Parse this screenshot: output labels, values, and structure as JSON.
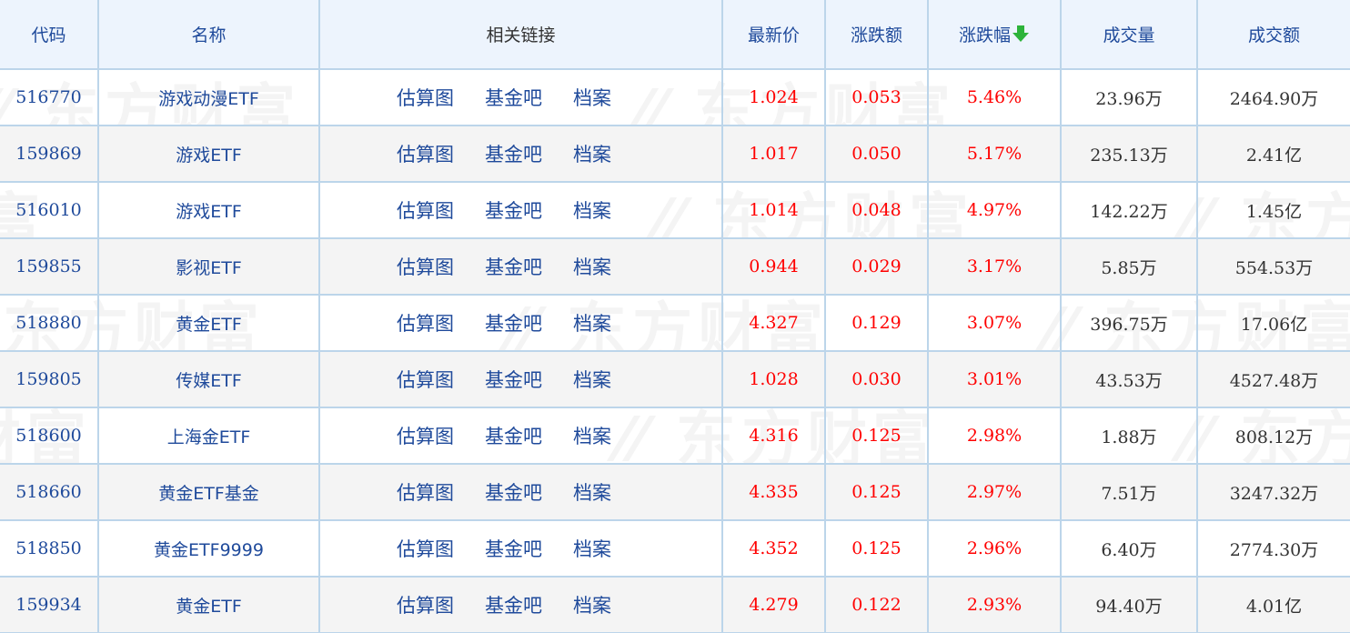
{
  "watermark_text": "东方财富",
  "colors": {
    "header_bg": "#edf4fd",
    "border": "#bcd5ea",
    "link_blue": "#1f4a9b",
    "up_red": "#ff0000",
    "sort_arrow_green": "#2db33a",
    "alt_row_bg": "#f4f4f4"
  },
  "table": {
    "headers": [
      {
        "label": "代码",
        "sortable": true
      },
      {
        "label": "名称",
        "sortable": true
      },
      {
        "label": "相关链接",
        "sortable": false
      },
      {
        "label": "最新价",
        "sortable": true
      },
      {
        "label": "涨跌额",
        "sortable": true
      },
      {
        "label": "涨跌幅",
        "sortable": true,
        "sorted": "desc",
        "icon": "sort-down-arrow-icon"
      },
      {
        "label": "成交量",
        "sortable": true
      },
      {
        "label": "成交额",
        "sortable": true
      }
    ],
    "link_labels": [
      "估算图",
      "基金吧",
      "档案"
    ],
    "rows": [
      {
        "code": "516770",
        "name": "游戏动漫ETF",
        "price": "1.024",
        "change": "0.053",
        "change_pct": "5.46%",
        "volume": "23.96万",
        "amount": "2464.90万"
      },
      {
        "code": "159869",
        "name": "游戏ETF",
        "price": "1.017",
        "change": "0.050",
        "change_pct": "5.17%",
        "volume": "235.13万",
        "amount": "2.41亿"
      },
      {
        "code": "516010",
        "name": "游戏ETF",
        "price": "1.014",
        "change": "0.048",
        "change_pct": "4.97%",
        "volume": "142.22万",
        "amount": "1.45亿"
      },
      {
        "code": "159855",
        "name": "影视ETF",
        "price": "0.944",
        "change": "0.029",
        "change_pct": "3.17%",
        "volume": "5.85万",
        "amount": "554.53万"
      },
      {
        "code": "518880",
        "name": "黄金ETF",
        "price": "4.327",
        "change": "0.129",
        "change_pct": "3.07%",
        "volume": "396.75万",
        "amount": "17.06亿"
      },
      {
        "code": "159805",
        "name": "传媒ETF",
        "price": "1.028",
        "change": "0.030",
        "change_pct": "3.01%",
        "volume": "43.53万",
        "amount": "4527.48万"
      },
      {
        "code": "518600",
        "name": "上海金ETF",
        "price": "4.316",
        "change": "0.125",
        "change_pct": "2.98%",
        "volume": "1.88万",
        "amount": "808.12万"
      },
      {
        "code": "518660",
        "name": "黄金ETF基金",
        "price": "4.335",
        "change": "0.125",
        "change_pct": "2.97%",
        "volume": "7.51万",
        "amount": "3247.32万"
      },
      {
        "code": "518850",
        "name": "黄金ETF9999",
        "price": "4.352",
        "change": "0.125",
        "change_pct": "2.96%",
        "volume": "6.40万",
        "amount": "2774.30万"
      },
      {
        "code": "159934",
        "name": "黄金ETF",
        "price": "4.279",
        "change": "0.122",
        "change_pct": "2.93%",
        "volume": "94.40万",
        "amount": "4.01亿"
      }
    ]
  }
}
